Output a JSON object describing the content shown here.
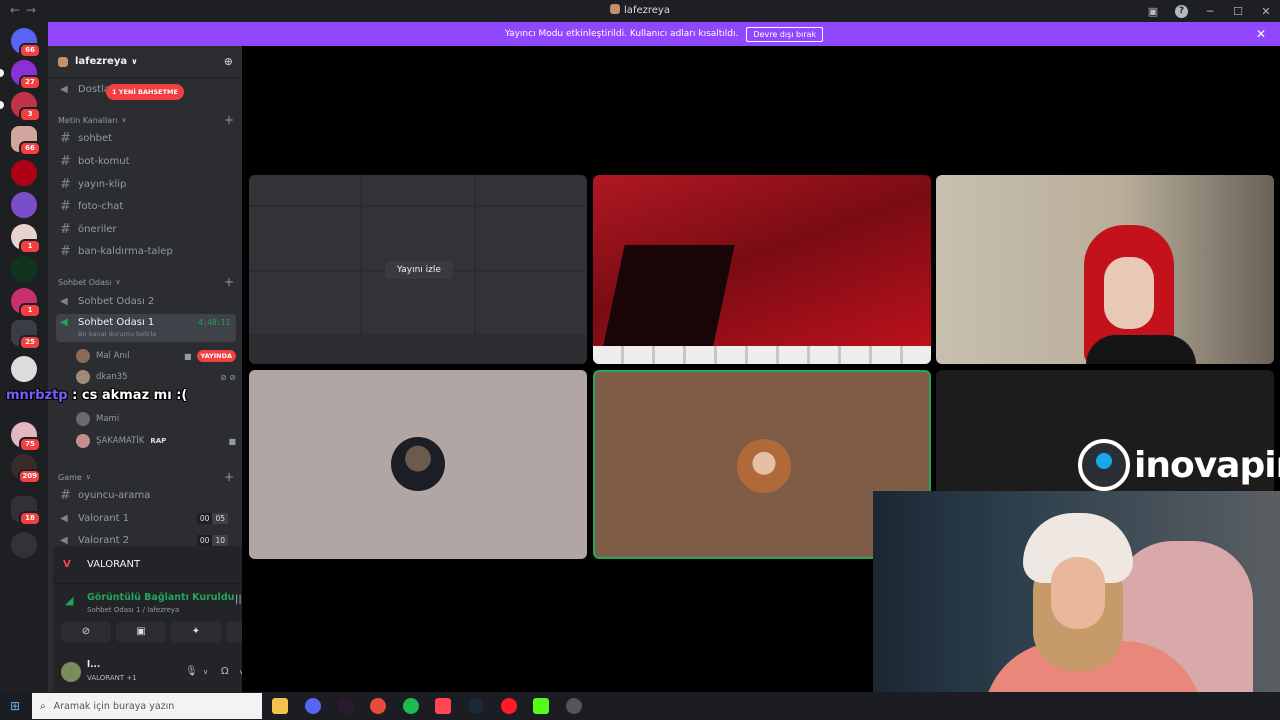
{
  "window": {
    "title": "lafezreya"
  },
  "banner": {
    "message": "Yayıncı Modu etkinleştirildi. Kullanıcı adları kısaltıldı.",
    "button": "Devre dışı bırak"
  },
  "rail": {
    "badges": [
      "66",
      "27",
      "3",
      "66",
      "1",
      "1",
      "25",
      "75",
      "209",
      "18"
    ]
  },
  "server": {
    "name": "lafezreya"
  },
  "channels": {
    "top_voice": "Dostla",
    "mention_pill": "1 YENİ BAHSETME",
    "text_category": "Metin Kanalları",
    "text": [
      "sohbet",
      "bot-komut",
      "yayın-klip",
      "foto-chat",
      "öneriler",
      "ban-kaldırma-talep"
    ],
    "voice_category": "Sohbet Odası",
    "voice": [
      {
        "name": "Sohbet Odası 2"
      },
      {
        "name": "Sohbet Odası 1",
        "timer": "4:48:11",
        "status": "Bir kanal durumu belirle"
      }
    ],
    "users": [
      {
        "name": "Mal Anıl",
        "tag": "YAYINDA",
        "color": "#8a6b5a"
      },
      {
        "name": "dkan35",
        "color": "#a08a7a"
      },
      {
        "name": "Mami",
        "color": "#6b6b6b"
      },
      {
        "name": "ŞAKAMATİK",
        "tag": "RAP",
        "color": "#c98b8b"
      }
    ],
    "game_category": "Game",
    "game": [
      {
        "type": "text",
        "name": "oyuncu-arama"
      },
      {
        "type": "voice",
        "name": "Valorant 1",
        "count": [
          "00",
          "05"
        ]
      },
      {
        "type": "voice",
        "name": "Valorant 2",
        "count": [
          "00",
          "10"
        ]
      }
    ]
  },
  "activity": {
    "game": "VALORANT"
  },
  "voice_status": {
    "status": "Görüntülü Bağlantı Kuruldu",
    "location": "Sohbet Odası 1 / lafezreya"
  },
  "user_panel": {
    "name": "l...",
    "activity": "VALORANT +1"
  },
  "stage": {
    "watch_label": "Yayını izle"
  },
  "overlay": {
    "chat_nick": "mnrbztp",
    "chat_msg": ": cs akmaz mı :(",
    "sponsor": "inovapin"
  },
  "taskbar": {
    "search_placeholder": "Aramak için buraya yazın"
  },
  "colors": {
    "accent": "#9147ff",
    "online": "#23a55a",
    "danger": "#f23f42"
  }
}
